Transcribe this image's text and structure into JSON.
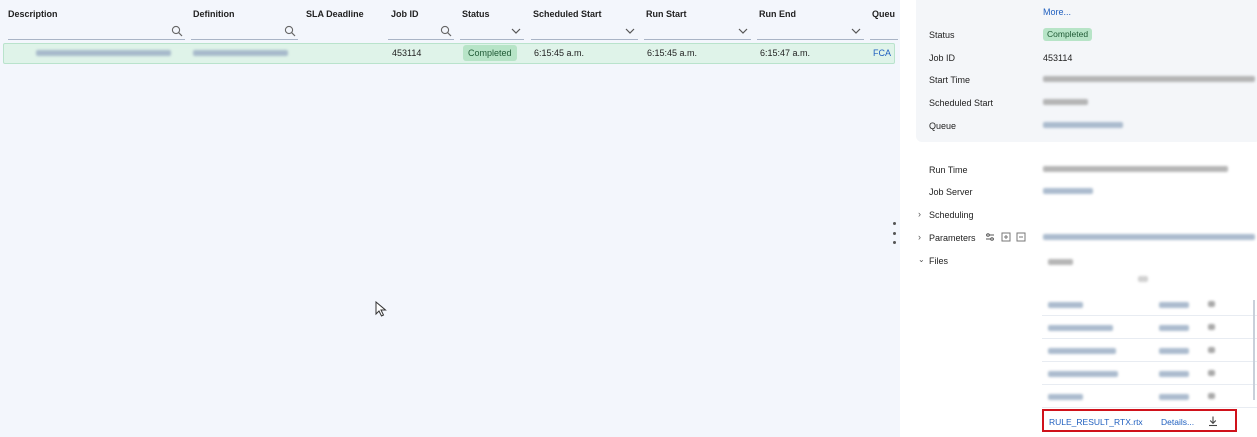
{
  "grid": {
    "columns": {
      "description": "Description",
      "definition": "Definition",
      "sla_deadline": "SLA Deadline",
      "job_id": "Job ID",
      "status": "Status",
      "scheduled_start": "Scheduled Start",
      "run_start": "Run Start",
      "run_end": "Run End",
      "queue": "Queu"
    },
    "row": {
      "job_id": "453114",
      "status": "Completed",
      "scheduled_start": "6:15:45 a.m.",
      "run_start": "6:15:45 a.m.",
      "run_end": "6:15:47 a.m.",
      "queue": "FCA"
    }
  },
  "panel": {
    "more_link": "More...",
    "status_label": "Status",
    "status_value": "Completed",
    "job_id_label": "Job ID",
    "job_id_value": "453114",
    "start_time_label": "Start Time",
    "scheduled_start_label": "Scheduled Start",
    "queue_label": "Queue",
    "run_time_label": "Run Time",
    "job_server_label": "Job Server",
    "scheduling_label": "Scheduling",
    "parameters_label": "Parameters",
    "files_label": "Files",
    "file_name": "RULE_RESULT_RTX.rtx",
    "file_details": "Details..."
  },
  "colors": {
    "completed_badge": "#b7e4c7",
    "selected_row": "#dff3e9",
    "link": "#1f5fbf",
    "highlight_border": "#d0121b"
  },
  "icons": {
    "filter": "search-icon",
    "dropdown": "chevron-down-icon",
    "download": "download-icon",
    "expand": "chevron-right-icon",
    "collapse": "chevron-down-icon"
  }
}
